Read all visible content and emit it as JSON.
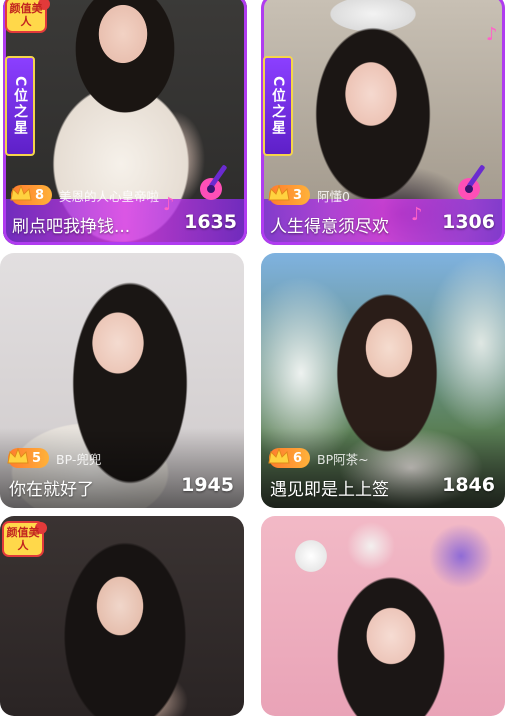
{
  "cards": [
    {
      "rank": "8",
      "host": "美恩的人心皇帝啦",
      "title": "刷点吧我挣钱...",
      "count": "1635",
      "ribbon": "C位之星",
      "beauty": "颜值美人"
    },
    {
      "rank": "3",
      "host": "阿懂0",
      "title": "人生得意须尽欢",
      "count": "1306",
      "ribbon": "C位之星"
    },
    {
      "rank": "5",
      "host": "BP-兜兜",
      "title": "你在就好了",
      "count": "1945"
    },
    {
      "rank": "6",
      "host": "BP阿茶~",
      "title": "遇见即是上上签",
      "count": "1846"
    },
    {
      "beauty": "颜值美人"
    },
    {}
  ],
  "colors": {
    "frame": "#b03cf0",
    "rank_badge": "#ff9a30",
    "ribbon": "#7a2fe8"
  },
  "icons": [
    "crown-icon",
    "beauty-badge-icon",
    "guitar-icon",
    "music-note-icon"
  ]
}
